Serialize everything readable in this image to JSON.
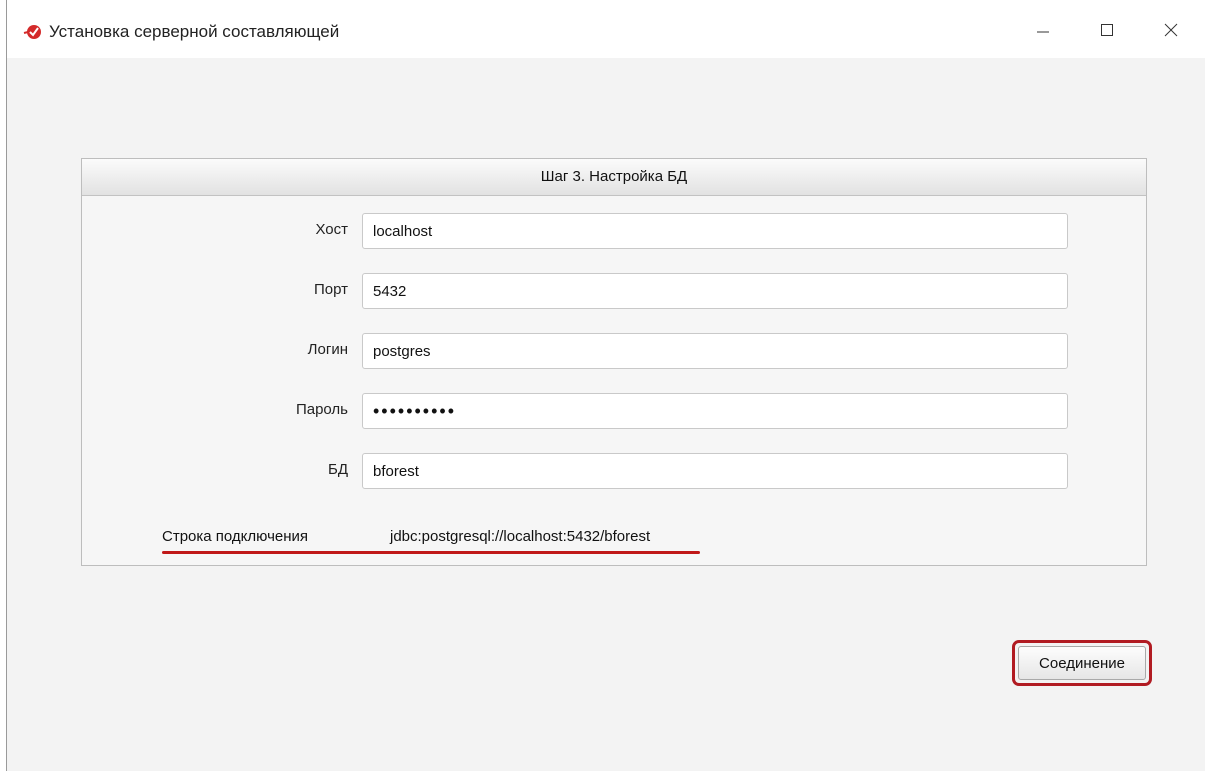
{
  "window": {
    "title": "Установка серверной составляющей",
    "icon": "app-logo-icon",
    "controls": [
      "minimize-icon",
      "maximize-icon",
      "close-icon"
    ]
  },
  "panel": {
    "header": "Шаг 3. Настройка БД",
    "fields": {
      "host": {
        "label": "Хост",
        "value": "localhost"
      },
      "port": {
        "label": "Порт",
        "value": "5432"
      },
      "login": {
        "label": "Логин",
        "value": "postgres"
      },
      "password": {
        "label": "Пароль",
        "value": "••••••••••"
      },
      "db": {
        "label": "БД",
        "value": "bforest"
      }
    },
    "connection": {
      "label": "Строка подключения",
      "value": "jdbc:postgresql://localhost:5432/bforest"
    }
  },
  "actions": {
    "connect_label": "Соединение"
  },
  "colors": {
    "highlight": "#b11b22",
    "underline": "#c01818"
  }
}
